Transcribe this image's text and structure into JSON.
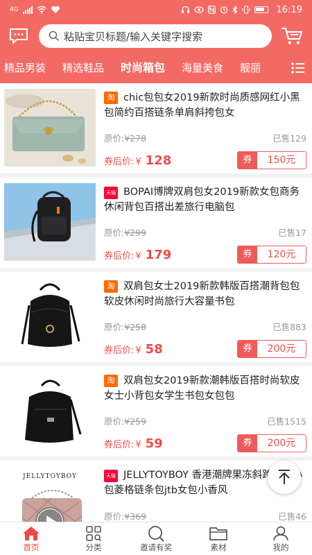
{
  "status": {
    "signal": "4G",
    "time": "16:19"
  },
  "header": {
    "search_placeholder": "粘贴宝贝标题/输入关键字搜索"
  },
  "tabs": [
    {
      "label": "精品男装",
      "active": false
    },
    {
      "label": "精选鞋品",
      "active": false
    },
    {
      "label": "时尚箱包",
      "active": true
    },
    {
      "label": "海量美食",
      "active": false
    },
    {
      "label": "靓丽",
      "active": false
    }
  ],
  "products": [
    {
      "shop": "taobao",
      "shop_badge": "淘",
      "title": "chic包包女2019新款时尚质感网红小黑包简约百搭链条单肩斜挎包女",
      "orig_label": "原价:",
      "orig_price": "¥278",
      "sold": "已售129",
      "after_label": "券后价:",
      "after_currency": "¥",
      "after_price": "128",
      "coupon_tag": "券",
      "coupon_value": "150元"
    },
    {
      "shop": "tmall",
      "shop_badge": "天猫",
      "title": "BOPAI博牌双肩包女2019新款女包商务休闲背包百搭出差旅行电脑包",
      "orig_label": "原价:",
      "orig_price": "¥299",
      "sold": "已售17",
      "after_label": "券后价:",
      "after_currency": "¥",
      "after_price": "179",
      "coupon_tag": "券",
      "coupon_value": "120元"
    },
    {
      "shop": "taobao",
      "shop_badge": "淘",
      "title": "双肩包女士2019新款韩版百搭潮背包包软皮休闲时尚旅行大容量书包",
      "orig_label": "原价:",
      "orig_price": "¥258",
      "sold": "已售883",
      "after_label": "券后价:",
      "after_currency": "¥",
      "after_price": "58",
      "coupon_tag": "券",
      "coupon_value": "200元"
    },
    {
      "shop": "taobao",
      "shop_badge": "淘",
      "title": "双肩包女2019新款潮韩版百搭时尚软皮女士小背包女学生书包女包包",
      "orig_label": "原价:",
      "orig_price": "¥259",
      "sold": "已售1515",
      "after_label": "券后价:",
      "after_currency": "¥",
      "after_price": "59",
      "coupon_tag": "券",
      "coupon_value": "200元"
    },
    {
      "shop": "tmall",
      "shop_badge": "天猫",
      "title": "JELLYTOYBOY 香港潮牌果冻斜跨包女小包菱格链条包jtb女包小香风",
      "orig_label": "原价:",
      "orig_price": "¥369",
      "sold": "已售46",
      "after_label": "",
      "after_currency": "",
      "after_price": "",
      "coupon_tag": "",
      "coupon_value": "",
      "image_text": "JELLYTOYBOY"
    }
  ],
  "bottom_nav": [
    {
      "label": "首页",
      "icon": "home-icon",
      "active": true
    },
    {
      "label": "分类",
      "icon": "category-icon",
      "active": false
    },
    {
      "label": "邀请有奖",
      "icon": "invite-search-icon",
      "active": false
    },
    {
      "label": "素材",
      "icon": "folder-icon",
      "active": false
    },
    {
      "label": "我的",
      "icon": "user-icon",
      "active": false
    }
  ],
  "colors": {
    "brand": "#f36a64",
    "price": "#ef4b4b",
    "taobao": "#ff6a00",
    "tmall": "#ff0036"
  }
}
